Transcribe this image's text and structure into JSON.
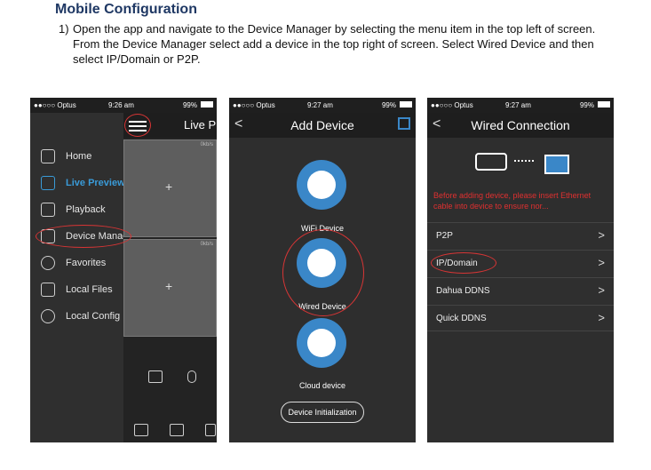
{
  "document": {
    "heading": "Mobile Configuration",
    "step_number": "1)",
    "step_text": "Open the app and navigate to the Device Manager by selecting the menu item in the top left of screen. From the Device Manager select add a device in the top right of screen. Select Wired Device and then select IP/Domain or P2P."
  },
  "phone1": {
    "status": {
      "carrier": "●●○○○ Optus",
      "time": "9:26 am",
      "battery": "99%"
    },
    "title": "Live Pr",
    "menu": [
      {
        "label": "Home",
        "icon": "home-icon"
      },
      {
        "label": "Live Preview",
        "icon": "live-preview-icon"
      },
      {
        "label": "Playback",
        "icon": "playback-icon"
      },
      {
        "label": "Device Manag",
        "icon": "device-manager-icon"
      },
      {
        "label": "Favorites",
        "icon": "star-icon"
      },
      {
        "label": "Local Files",
        "icon": "folder-icon"
      },
      {
        "label": "Local Config",
        "icon": "settings-icon"
      }
    ],
    "tile_rate": "0kb/s",
    "tile_plus": "+"
  },
  "phone2": {
    "status": {
      "carrier": "●●○○○ Optus",
      "time": "9:27 am",
      "battery": "99%"
    },
    "title": "Add Device",
    "back": "<",
    "options": [
      {
        "label": "WiFi Device",
        "icon": "wifi-camera-icon"
      },
      {
        "label": "Wired Device",
        "icon": "wired-camera-icon"
      },
      {
        "label": "Cloud device",
        "icon": "cloud-download-icon"
      }
    ],
    "init_button": "Device Initialization"
  },
  "phone3": {
    "status": {
      "carrier": "●●○○○ Optus",
      "time": "9:27 am",
      "battery": "99%"
    },
    "title": "Wired Connection",
    "back": "<",
    "warning": "Before adding device, please insert Ethernet cable into device to ensure nor...",
    "rows": [
      {
        "label": "P2P"
      },
      {
        "label": "IP/Domain"
      },
      {
        "label": "Dahua DDNS"
      },
      {
        "label": "Quick DDNS"
      }
    ],
    "chevron": ">"
  },
  "colors": {
    "heading": "#1f3864",
    "accent_blue": "#3a87c8",
    "highlight_red": "#d83535",
    "warning_red": "#e03030"
  }
}
